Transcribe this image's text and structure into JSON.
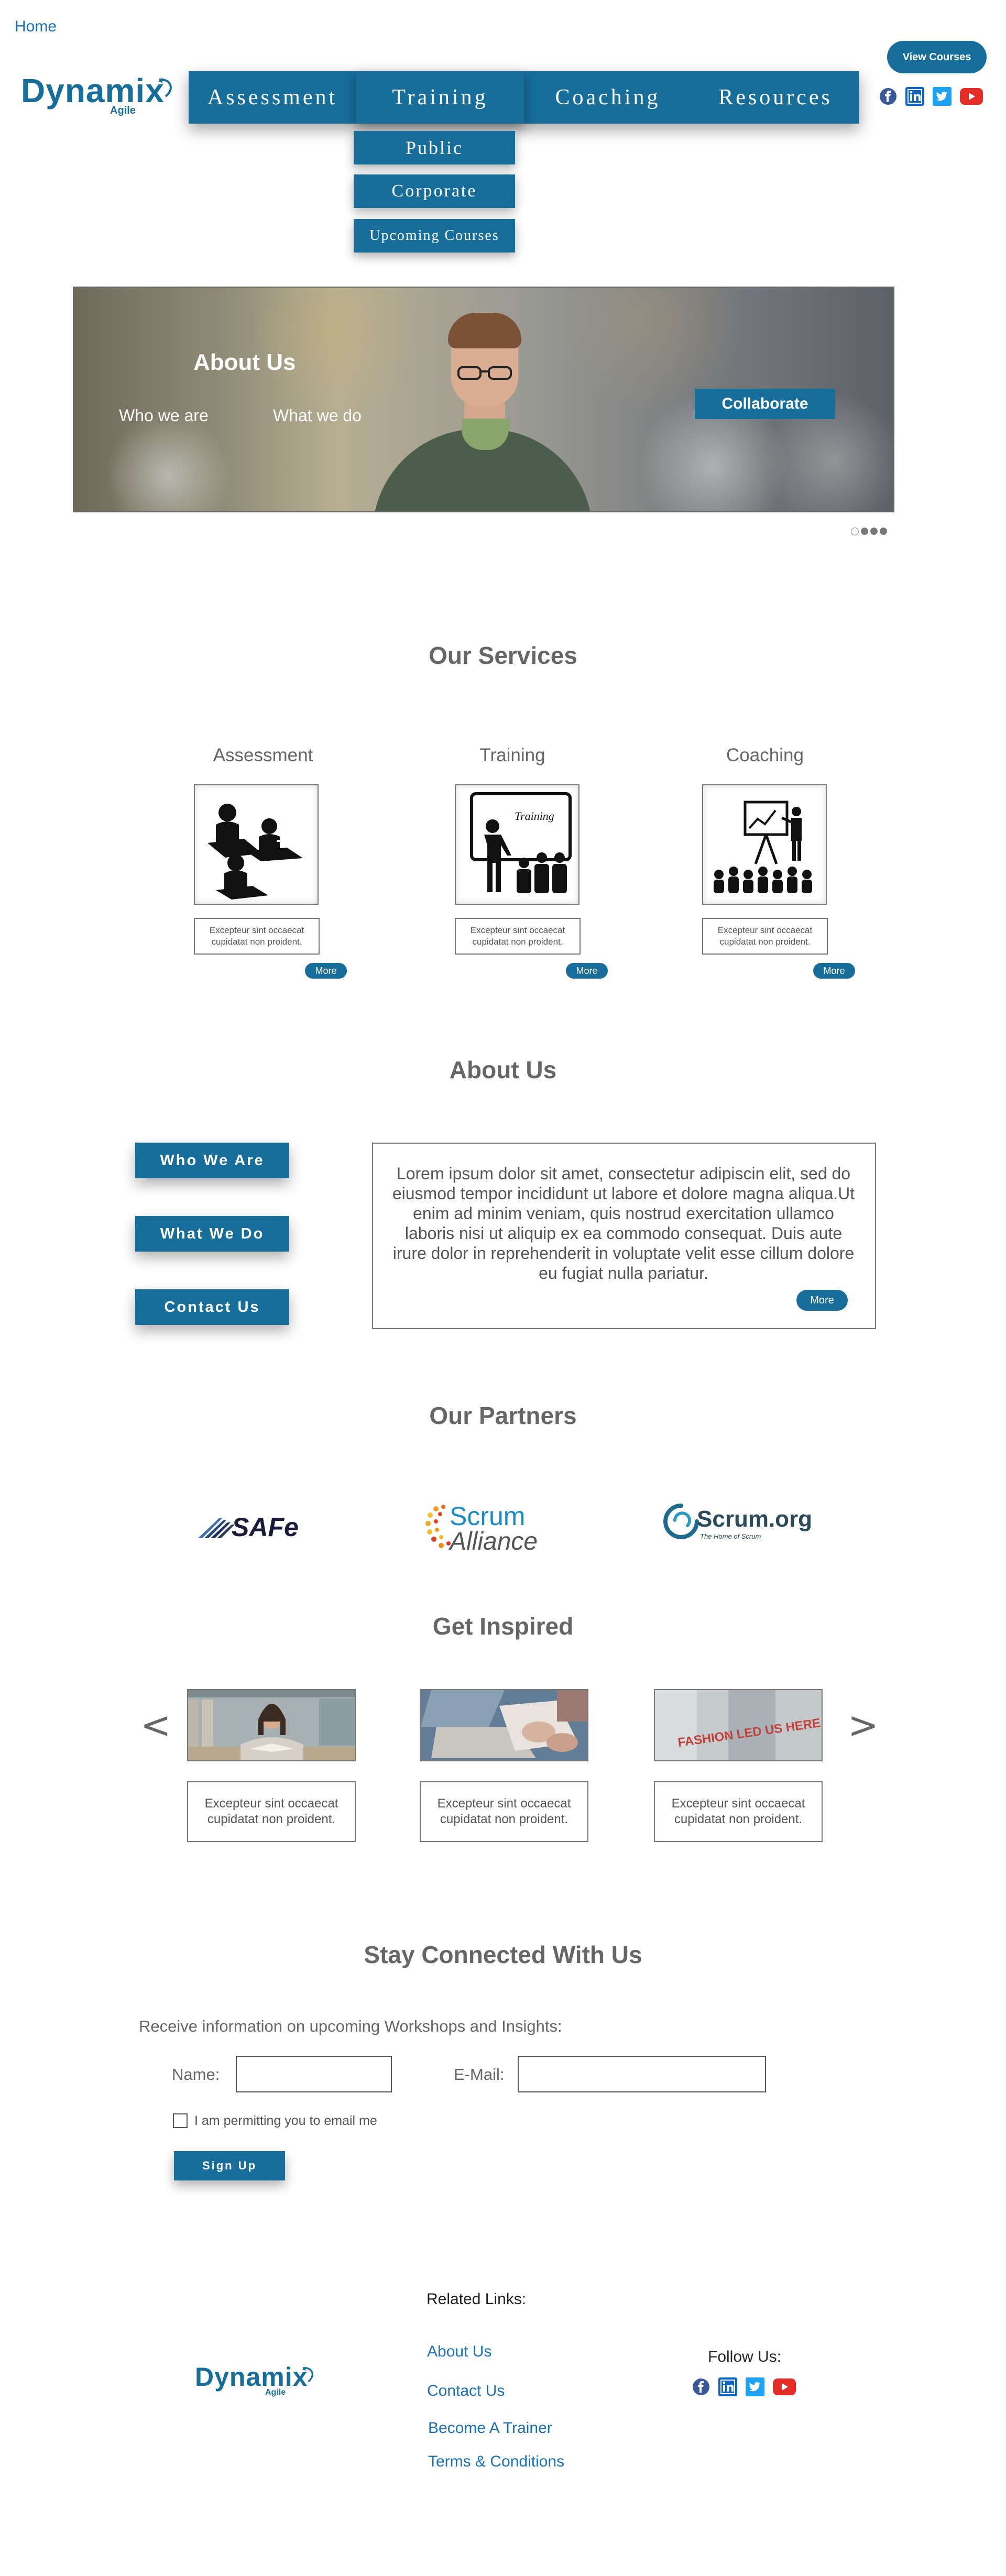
{
  "header": {
    "home_label": "Home",
    "view_courses_label": "View Courses",
    "logo": {
      "name": "Dynamix",
      "sub": "Agile"
    },
    "nav": [
      {
        "label": "Assessment"
      },
      {
        "label": "Training"
      },
      {
        "label": "Coaching"
      },
      {
        "label": "Resources"
      }
    ],
    "training_dropdown": [
      {
        "label": "Public"
      },
      {
        "label": "Corporate"
      },
      {
        "label": "Upcoming Courses"
      }
    ],
    "social_icons": [
      "facebook-icon",
      "linkedin-icon",
      "twitter-icon",
      "youtube-icon"
    ]
  },
  "hero": {
    "title": "About Us",
    "link_who": "Who we are",
    "link_what": "What we do",
    "collaborate_label": "Collaborate",
    "slides_count": 4,
    "active_slide": 1
  },
  "services": {
    "title": "Our Services",
    "items": [
      {
        "label": "Assessment",
        "text": "Excepteur sint occaecat cupidatat non proident.",
        "more_label": "More"
      },
      {
        "label": "Training",
        "text": "Excepteur sint occaecat cupidatat non proident.",
        "more_label": "More",
        "image_caption": "Training"
      },
      {
        "label": "Coaching",
        "text": "Excepteur sint occaecat cupidatat non proident.",
        "more_label": "More"
      }
    ]
  },
  "about": {
    "title": "About Us",
    "buttons": [
      {
        "label": "Who We Are"
      },
      {
        "label": "What We Do"
      },
      {
        "label": "Contact Us"
      }
    ],
    "text": "Lorem ipsum dolor sit amet, consectetur adipiscin elit, sed do eiusmod tempor incididunt ut labore et dolore magna aliqua.Ut enim ad minim veniam, quis nostrud exercitation ullamco laboris nisi ut aliquip ex ea commodo consequat. Duis aute irure dolor in reprehenderit in voluptate velit esse cillum dolore eu fugiat nulla pariatur.",
    "more_label": "More"
  },
  "partners": {
    "title": "Our Partners",
    "logos": [
      {
        "name": "SAFe"
      },
      {
        "name_top": "Scrum",
        "name_bottom": "Alliance"
      },
      {
        "name": "Scrum.org",
        "tagline": "The Home of Scrum"
      }
    ]
  },
  "inspired": {
    "title": "Get Inspired",
    "prev": "<",
    "next": ">",
    "items": [
      {
        "text": "Excepteur sint occaecat cupidatat non proident."
      },
      {
        "text": "Excepteur sint occaecat cupidatat non proident."
      },
      {
        "text": "Excepteur sint occaecat cupidatat non proident.",
        "image_caption": "FASHION LED US HERE"
      }
    ]
  },
  "stay_connected": {
    "title": "Stay Connected With Us",
    "intro": "Receive information on upcoming Workshops and Insights:",
    "name_label": "Name:",
    "name_value": "",
    "email_label": "E-Mail:",
    "email_value": "",
    "permission_label": "I am permitting you to email me",
    "permission_checked": false,
    "signup_label": "Sign Up"
  },
  "footer": {
    "related_title": "Related Links:",
    "links": [
      {
        "label": "About Us"
      },
      {
        "label": "Contact Us"
      },
      {
        "label": "Become A Trainer"
      },
      {
        "label": "Terms & Conditions"
      }
    ],
    "follow_label": "Follow Us:",
    "logo": {
      "name": "Dynamix",
      "sub": "Agile"
    }
  },
  "colors": {
    "brand_blue": "#176e9b",
    "link_blue": "#1b6fb3",
    "facebook": "#3b5998",
    "linkedin": "#0a66c2",
    "twitter": "#1da1f2",
    "youtube": "#e52d27"
  }
}
